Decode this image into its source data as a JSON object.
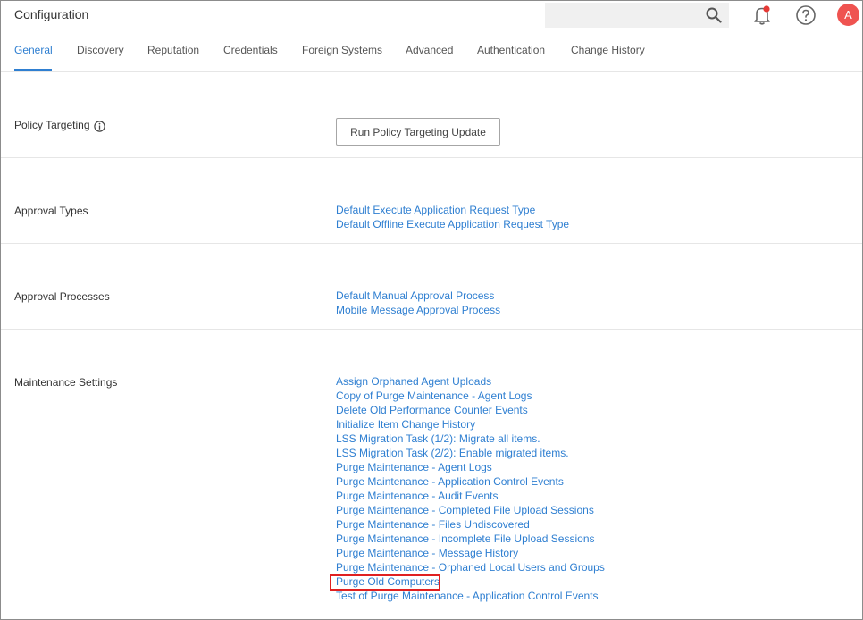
{
  "header": {
    "title": "Configuration",
    "avatar_initial": "A",
    "icons": [
      "search-icon",
      "bell-icon",
      "help-icon"
    ],
    "notification_dot_color": "#e53935",
    "avatar_color": "#ef5350"
  },
  "tabs": [
    {
      "label": "General",
      "active": true
    },
    {
      "label": "Discovery"
    },
    {
      "label": "Reputation"
    },
    {
      "label": "Credentials"
    },
    {
      "label": "Foreign Systems"
    },
    {
      "label": "Advanced"
    },
    {
      "label": "Authentication"
    },
    {
      "label": "Change History"
    }
  ],
  "sections": {
    "policy_targeting": {
      "label": "Policy Targeting",
      "button": "Run Policy Targeting Update"
    },
    "approval_types": {
      "label": "Approval Types",
      "links": [
        "Default Execute Application Request Type",
        "Default Offline Execute Application Request Type"
      ]
    },
    "approval_processes": {
      "label": "Approval Processes",
      "links": [
        "Default Manual Approval Process",
        "Mobile Message Approval Process"
      ]
    },
    "maintenance_settings": {
      "label": "Maintenance Settings",
      "links": [
        "Assign Orphaned Agent Uploads",
        "Copy of Purge Maintenance - Agent Logs",
        "Delete Old Performance Counter Events",
        "Initialize Item Change History",
        "LSS Migration Task (1/2): Migrate all items.",
        "LSS Migration Task (2/2): Enable migrated items.",
        "Purge Maintenance - Agent Logs",
        "Purge Maintenance - Application Control Events",
        "Purge Maintenance - Audit Events",
        "Purge Maintenance - Completed File Upload Sessions",
        "Purge Maintenance - Files Undiscovered",
        "Purge Maintenance - Incomplete File Upload Sessions",
        "Purge Maintenance - Message History",
        "Purge Maintenance - Orphaned Local Users and Groups",
        "Purge Old Computers",
        "Test of Purge Maintenance - Application Control Events"
      ]
    }
  },
  "colors": {
    "accent": "#2f7fd1",
    "highlight": "#e02020"
  }
}
